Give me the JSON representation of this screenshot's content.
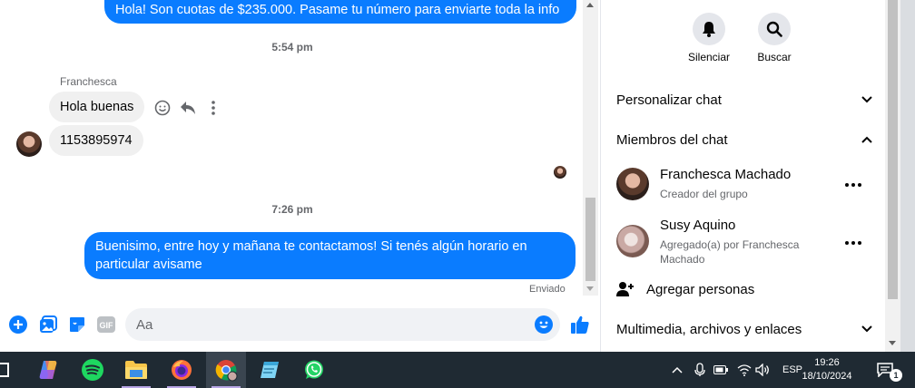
{
  "messages": {
    "out1": "Hola! Son cuotas de $235.000. Pasame tu número para enviarte toda la info",
    "time1": "5:54 pm",
    "sender1": "Franchesca",
    "in1": "Hola buenas",
    "in2": "1153895974",
    "time2": "7:26 pm",
    "out2": "Buenisimo, entre hoy y mañana te contactamos! Si tenés algún horario en particular avisame",
    "status": "Enviado"
  },
  "composer": {
    "placeholder": "Aa"
  },
  "info": {
    "mute_label": "Silenciar",
    "search_label": "Buscar",
    "customize": "Personalizar chat",
    "members_title": "Miembros del chat",
    "members": [
      {
        "name": "Franchesca Machado",
        "role": "Creador del grupo"
      },
      {
        "name": "Susy Aquino",
        "role": "Agregado(a) por Franchesca Machado"
      }
    ],
    "add_people": "Agregar personas",
    "media": "Multimedia, archivos y enlaces"
  },
  "taskbar": {
    "lang": "ESP",
    "time": "19:26",
    "date": "18/10/2024",
    "notif_count": "1"
  },
  "colors": {
    "accent": "#0a7cff",
    "taskbar": "#1f2a33"
  }
}
